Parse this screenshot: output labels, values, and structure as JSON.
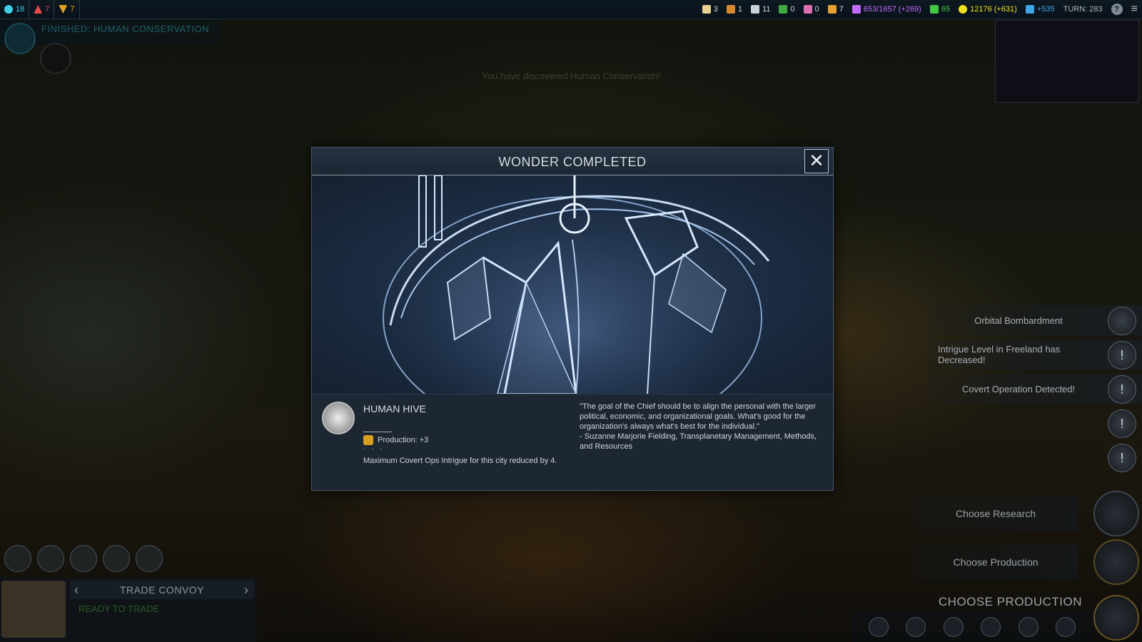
{
  "topbar": {
    "left": [
      {
        "icon": "affinity-harmony-icon",
        "value": "18",
        "color": "#3fd0e8"
      },
      {
        "icon": "affinity-purity-icon",
        "value": "7",
        "color": "#e84a4a"
      },
      {
        "icon": "affinity-supremacy-icon",
        "value": "7",
        "color": "#e8a020"
      }
    ],
    "resources": [
      {
        "icon": "firaxite-icon",
        "value": "3"
      },
      {
        "icon": "petroleum-icon",
        "value": "1"
      },
      {
        "icon": "titanium-icon",
        "value": "11"
      },
      {
        "icon": "geothermal-icon",
        "value": "0"
      },
      {
        "icon": "xenomass-icon",
        "value": "0"
      },
      {
        "icon": "floatstone-icon",
        "value": "7"
      }
    ],
    "culture": "653/1657 (+269)",
    "health": "65",
    "energy": "12176 (+631)",
    "science": "+535",
    "turn": "TURN: 283",
    "colors": {
      "culture": "#c26bff",
      "health": "#43c843",
      "energy": "#f0e020",
      "science": "#3fa8e8"
    }
  },
  "finished": {
    "text": "FINISHED: HUMAN CONSERVATION"
  },
  "discover_message": "You have discovered Human Conservation!",
  "dialog": {
    "title": "WONDER COMPLETED",
    "close_glyph": "✕",
    "wonder_name": "HUMAN HIVE",
    "production": "Production: +3",
    "dashes": "- - -",
    "effect": "Maximum Covert Ops Intrigue for this city reduced by 4.",
    "quote": "\"The goal of the Chief should be to align the personal with the larger political, economic, and organizational goals. What's good for the organization's always what's best for the individual.\"\n- Suzanne Marjorie Fielding, Transplanetary Management, Methods, and Resources"
  },
  "notifications": [
    {
      "text": "Orbital Bombardment"
    },
    {
      "text": "Intrigue Level in Freeland has Decreased!"
    },
    {
      "text": "Covert Operation Detected!"
    },
    {
      "text": ""
    },
    {
      "text": ""
    }
  ],
  "actions": {
    "choose_research": "Choose Research",
    "choose_production": "Choose Production",
    "choose_production_title": "CHOOSE PRODUCTION"
  },
  "unit": {
    "name": "TRADE CONVOY",
    "status": "READY TO TRADE",
    "prev": "‹",
    "next": "›"
  },
  "help_glyph": "?",
  "menu_glyph": "≡",
  "exclaim_glyph": "!"
}
